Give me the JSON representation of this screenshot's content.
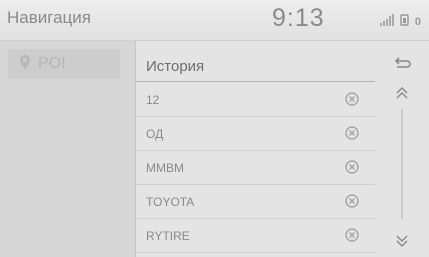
{
  "topbar": {
    "title": "Навигация",
    "clock": "9:13"
  },
  "status_icons": [
    "signal-icon",
    "phone-battery-icon",
    "notification-count-icon"
  ],
  "status": {
    "notification_count": "0"
  },
  "sidebar": {
    "poi_label": "POI"
  },
  "list": {
    "title": "История",
    "items": [
      {
        "label": "12"
      },
      {
        "label": "ОД"
      },
      {
        "label": "ММВМ"
      },
      {
        "label": "TOYOTA"
      },
      {
        "label": "RYTIRE"
      }
    ]
  }
}
